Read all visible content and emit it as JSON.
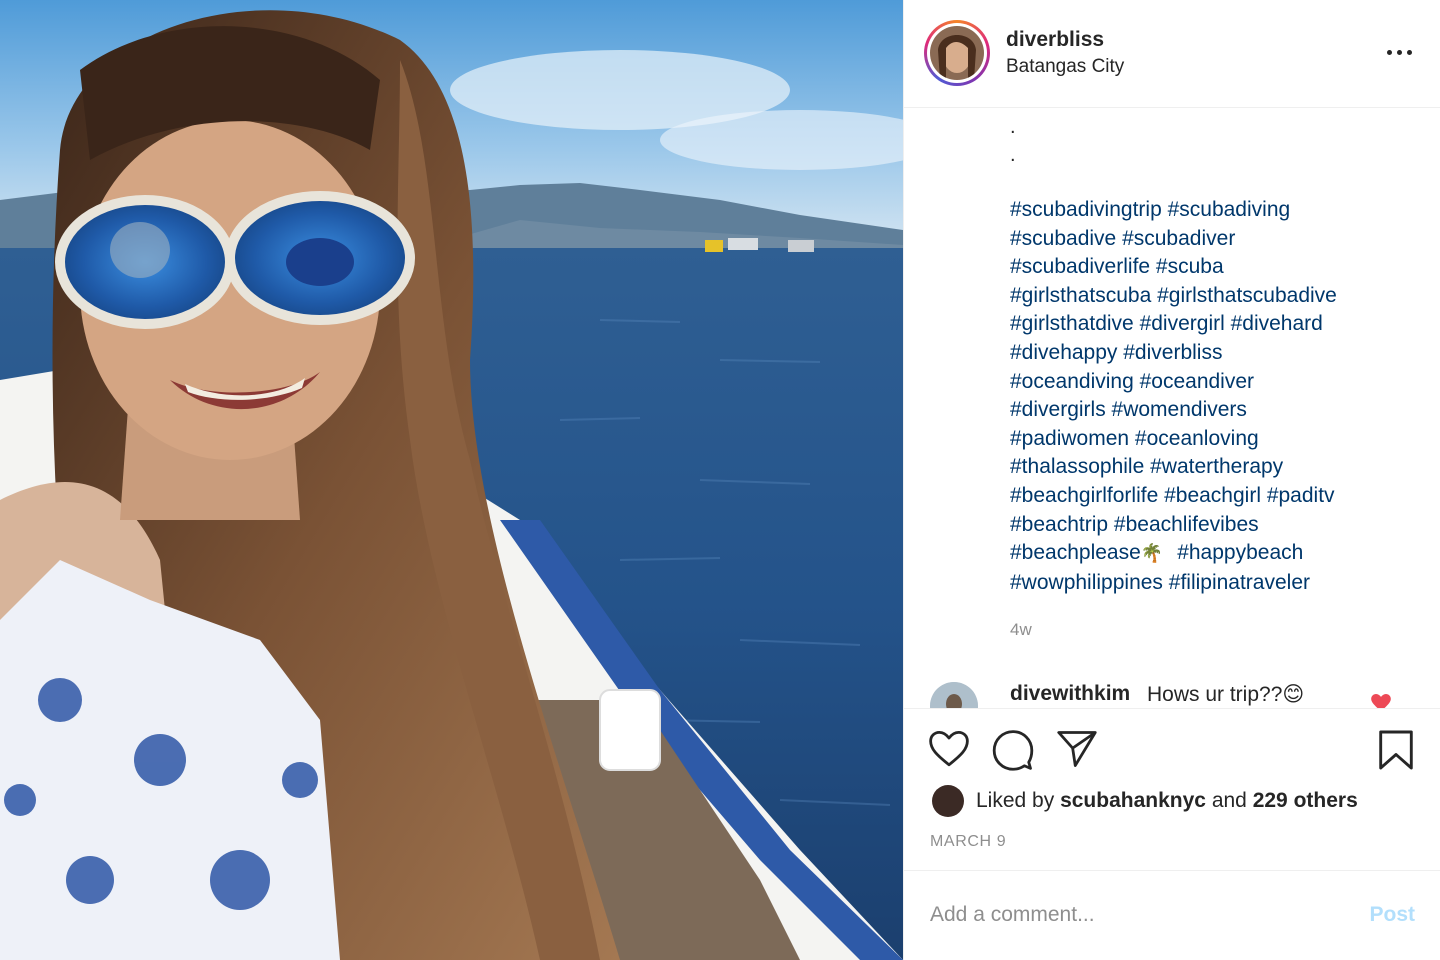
{
  "post": {
    "image_alt": "Selfie of a smiling woman in mirrored sunglasses on a white boat with the sea behind her"
  },
  "header": {
    "username": "diverbliss",
    "location": "Batangas City",
    "more_icon": "more-options-icon"
  },
  "caption": {
    "dot1": ".",
    "dot2": ".",
    "hashtags": [
      "#scubadivingtrip #scubadiving",
      "#scubadive #scubadiver",
      "#scubadiverlife #scuba",
      "#girlsthatscuba #girlsthatscubadive",
      "#girlsthatdive #divergirl #divehard",
      "#divehappy #diverbliss",
      "#oceandiving #oceandiver",
      "#divergirls #womendivers",
      "#padiwomen #oceanloving",
      "#thalassophile #watertherapy",
      "#beachgirlforlife #beachgirl #paditv",
      "#beachtrip #beachlifevibes"
    ],
    "line13_tag1": "#beachplease",
    "line13_emoji": "🌴",
    "line13_tag2": "#happybeach",
    "line14": "#wowphilippines #filipinatraveler",
    "age": "4w"
  },
  "comment": {
    "username": "divewithkim",
    "text": "Hows ur trip??😊"
  },
  "actions": {
    "like_icon": "heart-icon",
    "comment_icon": "comment-icon",
    "share_icon": "share-icon",
    "save_icon": "bookmark-icon"
  },
  "likes": {
    "prefix": "Liked by",
    "user": "scubahanknyc",
    "joiner": "and",
    "others": "229 others"
  },
  "date": "MARCH 9",
  "comment_box": {
    "placeholder": "Add a comment...",
    "post_label": "Post"
  },
  "colors": {
    "hashtag": "#00376b",
    "muted": "#8e8e8e",
    "post_disabled": "#b2dffc",
    "heart_red": "#ed4956"
  }
}
